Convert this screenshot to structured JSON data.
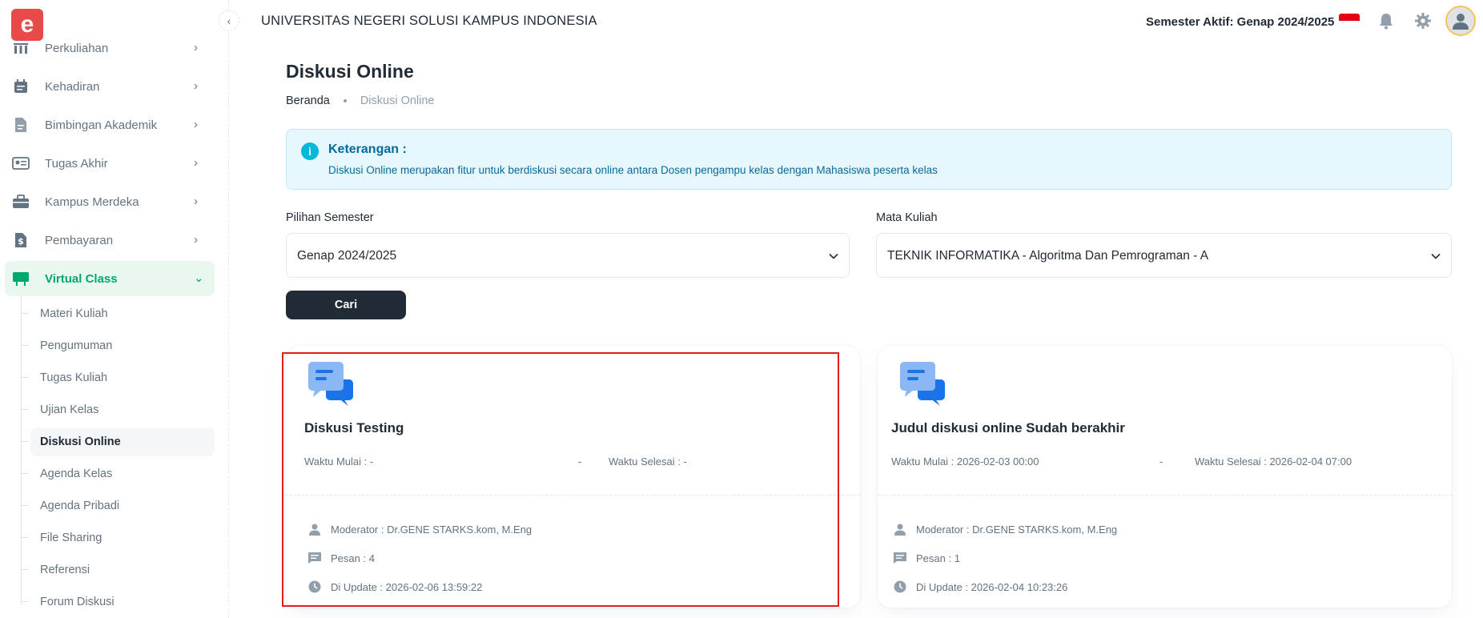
{
  "app": {
    "logo_letter": "e",
    "collapse_icon": "chevron-left-icon"
  },
  "header": {
    "title": "UNIVERSITAS NEGERI SOLUSI KAMPUS INDONESIA",
    "semester_label": "Semester Aktif: Genap 2024/2025",
    "icons": [
      "indonesia-flag-icon",
      "bell-icon",
      "gear-icon",
      "avatar-icon"
    ]
  },
  "sidebar": {
    "items": [
      {
        "label": "Perkuliahan",
        "icon": "building-icon"
      },
      {
        "label": "Kehadiran",
        "icon": "calendar-icon"
      },
      {
        "label": "Bimbingan Akademik",
        "icon": "document-icon"
      },
      {
        "label": "Tugas Akhir",
        "icon": "id-card-icon"
      },
      {
        "label": "Kampus Merdeka",
        "icon": "briefcase-icon"
      },
      {
        "label": "Pembayaran",
        "icon": "dollar-icon"
      },
      {
        "label": "Virtual Class",
        "icon": "board-icon"
      }
    ],
    "sub_items": [
      {
        "label": "Materi Kuliah"
      },
      {
        "label": "Pengumuman"
      },
      {
        "label": "Tugas Kuliah"
      },
      {
        "label": "Ujian Kelas"
      },
      {
        "label": "Diskusi Online"
      },
      {
        "label": "Agenda Kelas"
      },
      {
        "label": "Agenda Pribadi"
      },
      {
        "label": "File Sharing"
      },
      {
        "label": "Referensi"
      },
      {
        "label": "Forum Diskusi"
      }
    ],
    "active_item": "Virtual Class",
    "active_sub_item": "Diskusi Online"
  },
  "main": {
    "page_title": "Diskusi Online",
    "breadcrumb": [
      "Beranda",
      "Diskusi Online"
    ],
    "info": {
      "title": "Keterangan :",
      "text": "Diskusi Online merupakan fitur untuk berdiskusi secara online antara Dosen pengampu kelas dengan Mahasiswa peserta kelas"
    },
    "filters": {
      "semester_label": "Pilihan Semester",
      "semester_value": "Genap 2024/2025",
      "course_label": "Mata Kuliah",
      "course_value": "TEKNIK INFORMATIKA - Algoritma Dan Pemrograman - A"
    },
    "search_button": "Cari",
    "cards": [
      {
        "title": "Diskusi Testing",
        "start": "Waktu Mulai : -",
        "separator": "-",
        "end": "Waktu Selesai : -",
        "moderator": "Moderator : Dr.GENE STARKS.kom, M.Eng",
        "messages": "Pesan : 4",
        "updated": "Di Update : 2026-02-06 13:59:22"
      },
      {
        "title": "Judul diskusi online Sudah berakhir",
        "start": "Waktu Mulai : 2026-02-03 00:00",
        "separator": "-",
        "end": "Waktu Selesai : 2026-02-04 07:00",
        "moderator": "Moderator : Dr.GENE STARKS.kom, M.Eng",
        "messages": "Pesan : 1",
        "updated": "Di Update : 2026-02-04 10:23:26"
      }
    ]
  },
  "colors": {
    "accent": "#00a76f",
    "info_bg": "#e6f8fd",
    "info_text": "#006c9c",
    "highlight": "#e31c1c",
    "logo": "#e84a4a",
    "button_dark": "#212b36"
  }
}
